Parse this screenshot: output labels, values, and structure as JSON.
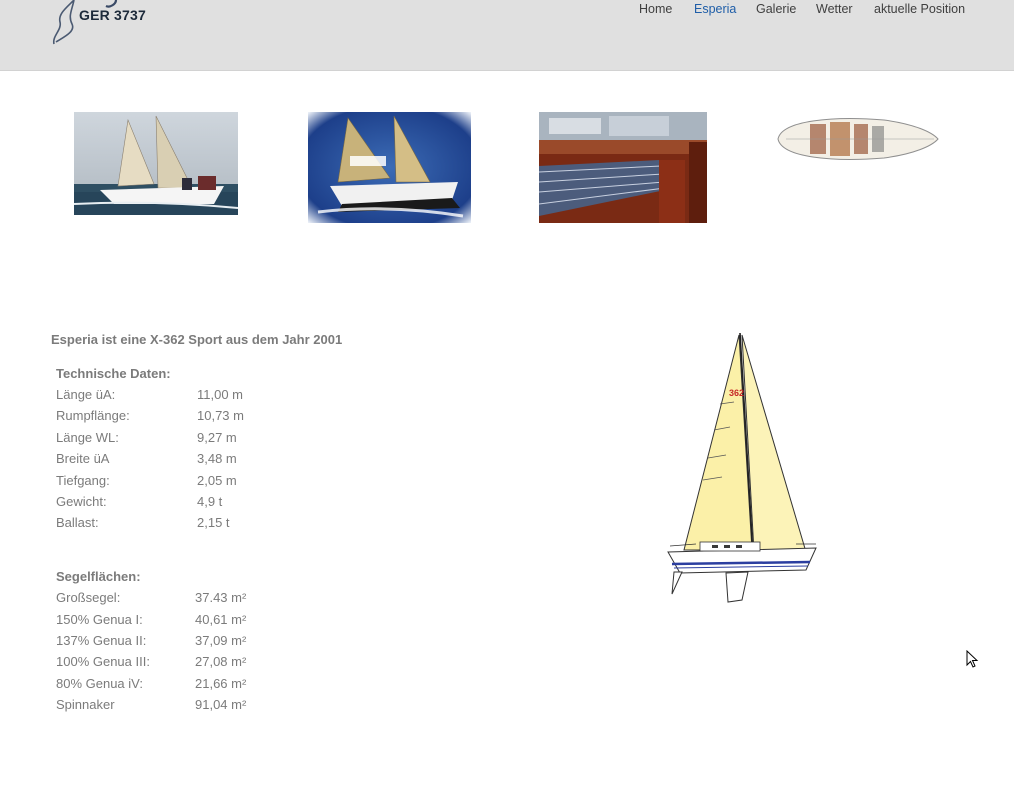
{
  "header": {
    "logo_text": "GER 3737",
    "nav": [
      {
        "label": "Home",
        "active": false
      },
      {
        "label": "Esperia",
        "active": true
      },
      {
        "label": "Galerie",
        "active": false
      },
      {
        "label": "Wetter",
        "active": false
      },
      {
        "label": "aktuelle Position",
        "active": false
      }
    ],
    "active_color": "#1f5ea8"
  },
  "gallery": [
    {
      "name": "sailing-photo-1"
    },
    {
      "name": "sailing-photo-2"
    },
    {
      "name": "cabin-interior-photo"
    },
    {
      "name": "deck-plan-drawing"
    }
  ],
  "main": {
    "title": "Esperia ist eine X-362 Sport aus dem Jahr 2001",
    "tech_heading": "Technische Daten:",
    "tech": [
      {
        "key": "Länge üA:",
        "value": "11,00 m"
      },
      {
        "key": "Rumpflänge:",
        "value": "10,73 m"
      },
      {
        "key": "Länge WL:",
        "value": "9,27 m"
      },
      {
        "key": "Breite üA",
        "value": "3,48 m"
      },
      {
        "key": "Tiefgang:",
        "value": "2,05 m"
      },
      {
        "key": "Gewicht:",
        "value": "4,9 t"
      },
      {
        "key": "Ballast:",
        "value": "2,15 t"
      }
    ],
    "sail_heading": "Segelflächen:",
    "sails": [
      {
        "key": "Großsegel:",
        "value": "37.43 m²"
      },
      {
        "key": "150% Genua I:",
        "value": "40,61 m²"
      },
      {
        "key": "137% Genua II:",
        "value": "37,09 m²"
      },
      {
        "key": "100% Genua III:",
        "value": "27,08 m²"
      },
      {
        "key": "80% Genua iV:",
        "value": "21,66 m²"
      },
      {
        "key": "Spinnaker",
        "value": "91,04 m²"
      }
    ],
    "sail_number_text": "362"
  }
}
